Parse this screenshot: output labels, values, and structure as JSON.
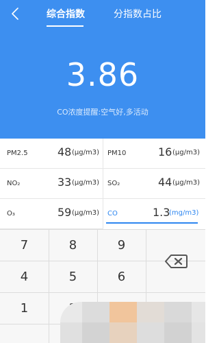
{
  "header": {
    "tabs": [
      {
        "label": "综合指数",
        "active": true
      },
      {
        "label": "分指数占比",
        "active": false
      }
    ]
  },
  "summary": {
    "value": "3.86",
    "tip": "CO浓度提醒:空气好,多活动"
  },
  "pollutants": [
    {
      "name": "PM2.5",
      "value": "48",
      "unit": "(μg/m3)"
    },
    {
      "name": "PM10",
      "value": "16",
      "unit": "(μg/m3)"
    },
    {
      "name": "NO₂",
      "value": "33",
      "unit": "(μg/m3)"
    },
    {
      "name": "SO₂",
      "value": "44",
      "unit": "(μg/m3)"
    },
    {
      "name": "O₃",
      "value": "59",
      "unit": "(μg/m3)"
    },
    {
      "name": "CO",
      "value": "1.3",
      "unit": "(mg/m3)",
      "active": true
    }
  ],
  "keypad": {
    "keys": [
      "7",
      "8",
      "9",
      "4",
      "5",
      "6",
      "1",
      "2"
    ],
    "backspace_icon": "backspace-icon"
  },
  "colors": {
    "primary": "#3d8ff0",
    "active": "#2d86f0"
  }
}
